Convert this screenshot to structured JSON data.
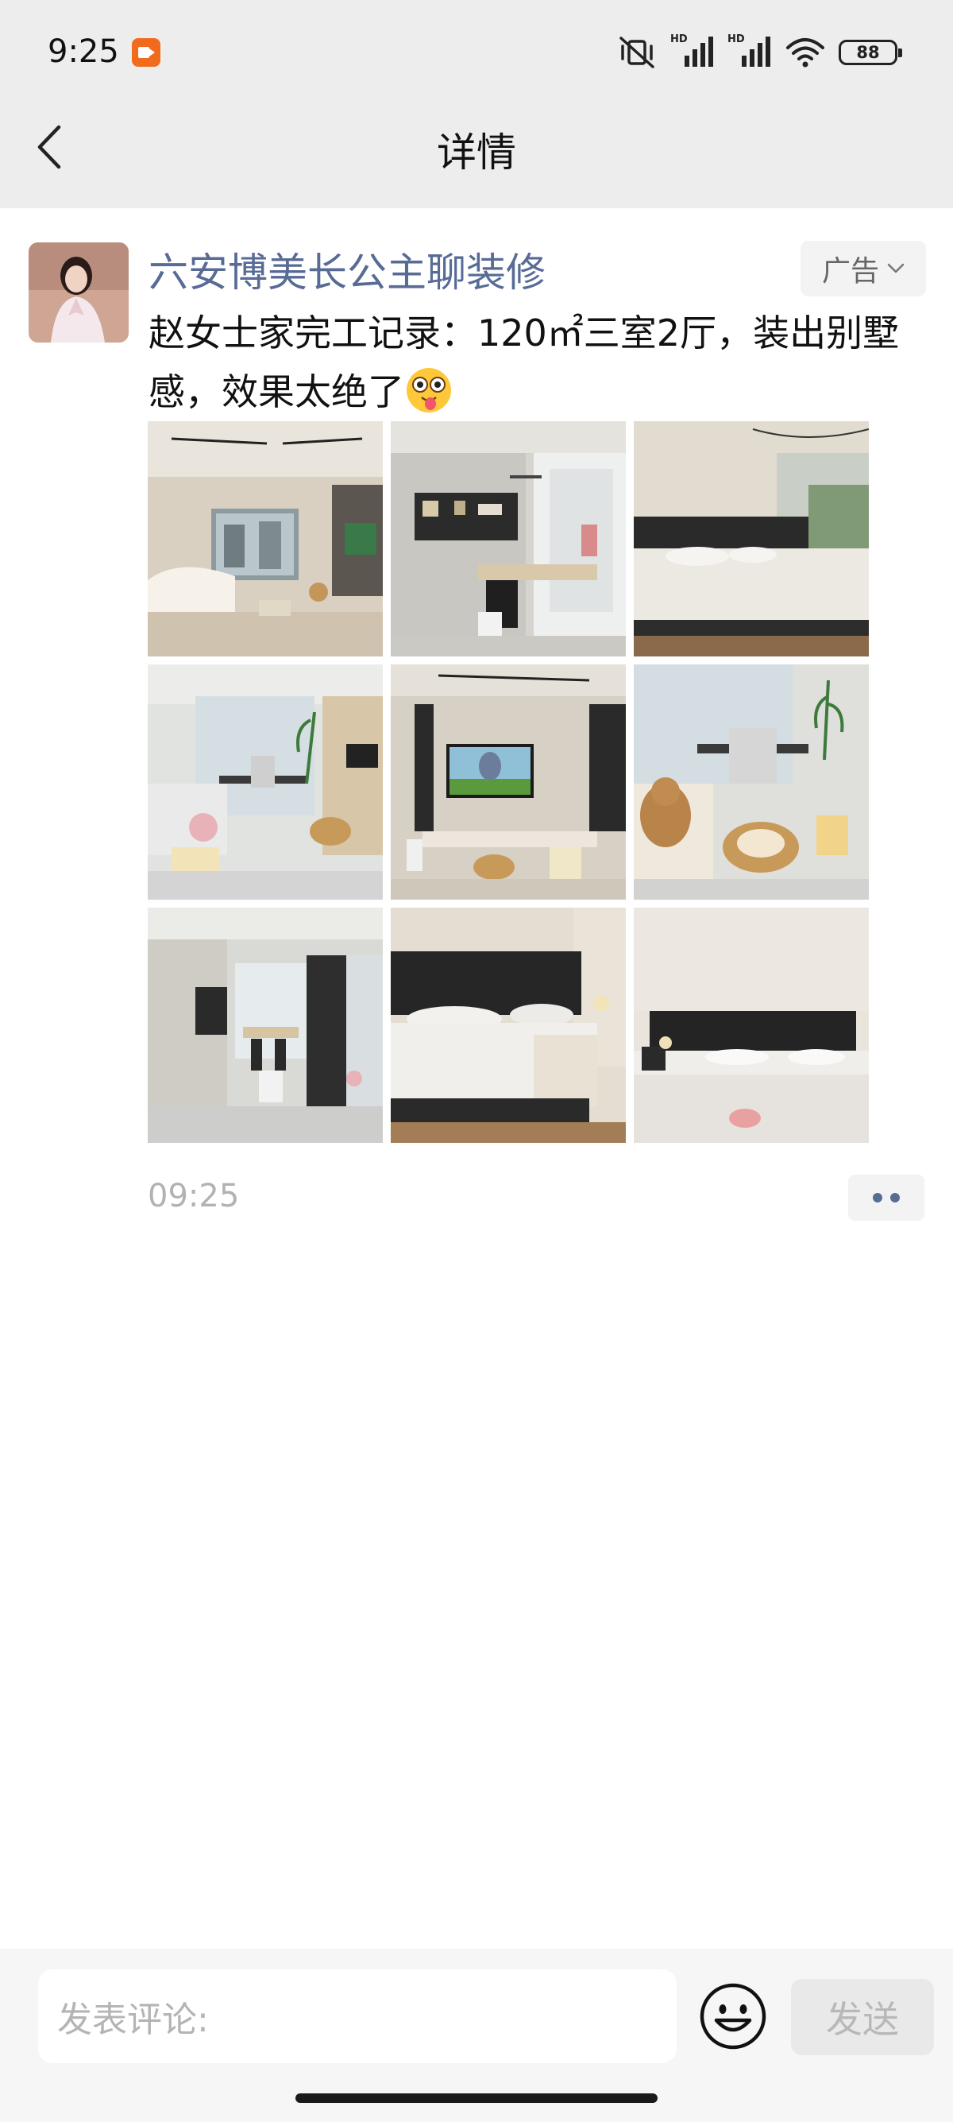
{
  "status_bar": {
    "time": "9:25",
    "hd_label_1": "HD",
    "hd_label_2": "HD",
    "battery": "88",
    "icons": [
      "screen-record-icon",
      "mute-vibrate-icon",
      "signal-icon",
      "signal-icon",
      "wifi-icon",
      "battery-icon"
    ]
  },
  "header": {
    "title": "详情",
    "back_icon": "chevron-left-icon"
  },
  "post": {
    "author": "六安博美长公主聊装修",
    "ad_label": "广告",
    "text": "赵女士家完工记录：120㎡三室2厅，装出别墅感，效果太绝了",
    "emoji_icon": "star-eyes-emoji",
    "time": "09:25",
    "photos": [
      {
        "scene": "living-room"
      },
      {
        "scene": "dining-cabinet"
      },
      {
        "scene": "bedroom"
      },
      {
        "scene": "study-corner"
      },
      {
        "scene": "tv-wall"
      },
      {
        "scene": "cat-desk"
      },
      {
        "scene": "dining-hall"
      },
      {
        "scene": "bed-closeup"
      },
      {
        "scene": "bedroom-dark-headboard"
      }
    ]
  },
  "comment_bar": {
    "placeholder": "发表评论:",
    "emoji_icon": "smiley-icon",
    "send_label": "发送"
  }
}
